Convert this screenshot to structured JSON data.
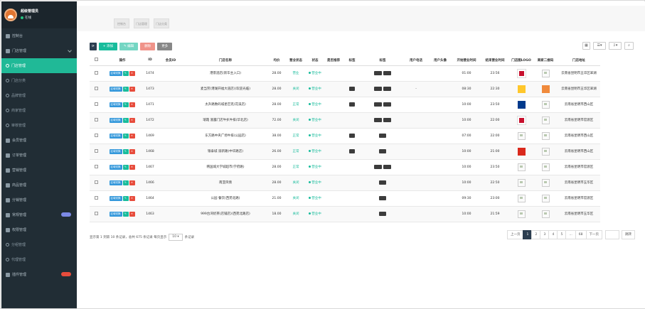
{
  "sidebar": {
    "user_name": "超级管理员",
    "user_status": "在线",
    "items": [
      {
        "label": "控制台",
        "type": "top"
      },
      {
        "label": "门店管理",
        "type": "top",
        "caret": true
      },
      {
        "label": "门店管理",
        "type": "active"
      },
      {
        "label": "门店分类",
        "type": "sub"
      },
      {
        "label": "品牌管理",
        "type": "sub"
      },
      {
        "label": "商家管理",
        "type": "sub"
      },
      {
        "label": "审核管理",
        "type": "sub"
      },
      {
        "label": "会员管理",
        "type": "top"
      },
      {
        "label": "订单管理",
        "type": "top"
      },
      {
        "label": "营销管理",
        "type": "top"
      },
      {
        "label": "商品管理",
        "type": "top"
      },
      {
        "label": "分销管理",
        "type": "top"
      },
      {
        "label": "常规管理",
        "type": "top",
        "badge_color": "#7c8ae6"
      },
      {
        "label": "权限管理",
        "type": "top"
      },
      {
        "label": "分组管理",
        "type": "sub"
      },
      {
        "label": "代理管理",
        "type": "sub"
      },
      {
        "label": "插件管理",
        "type": "top",
        "badge_color": "#e74c3c"
      }
    ]
  },
  "tabs": [
    "控制台",
    "门店管理",
    "门店分类"
  ],
  "toolbar": {
    "refresh": "⟳",
    "add": "+ 添加",
    "edit": "✎ 编辑",
    "delete": "删除",
    "more": "更多"
  },
  "table": {
    "headers": [
      "",
      "操作",
      "ID",
      "会员ID",
      "门店名称",
      "均价",
      "营业状态",
      "状态",
      "是否推荐",
      "标签",
      "标签",
      "用户电话",
      "用户头像",
      "开始营业时间",
      "结束营业时间",
      "门店图LOGO",
      "商家二维码",
      "门店地址"
    ],
    "rows": [
      {
        "id": "1474",
        "name": "港景酒店(新华主入口)",
        "price": "28.00",
        "open": "营业",
        "status": "营业中",
        "tags": "2",
        "phone": "",
        "start": "01:00",
        "end": "23:56",
        "logo": "kfc",
        "addr": "云南省昆明市五华区翠湖"
      },
      {
        "id": "1473",
        "name": "麦当劳(港湖开福大道店)(欢迎光临)",
        "price": "28.00",
        "open": "关闭",
        "status": "营业中",
        "tags": "2b",
        "phone": "-",
        "start": "08:30",
        "end": "22:30",
        "logo": "mcd",
        "addr": "云南省昆明市五华区翠湖"
      },
      {
        "id": "1471",
        "name": "太升路数码城星巴克(花溪店)",
        "price": "28.00",
        "open": "正常",
        "status": "营业中",
        "tags": "2b",
        "phone": "",
        "start": "10:00",
        "end": "23:50",
        "logo": "blue",
        "addr": "云南省昆明市西山区"
      },
      {
        "id": "1472",
        "name": "瑞霞 富露门店牛扒牛排(华北店)",
        "price": "72.00",
        "open": "关闭",
        "status": "营业中",
        "tags": "2",
        "phone": "",
        "start": "10:00",
        "end": "22:00",
        "logo": "kfc",
        "addr": "云南省昆明市官渡区"
      },
      {
        "id": "1469",
        "name": "东方路中央广场牛排(公园店)",
        "price": "38.00",
        "open": "正常",
        "status": "营业中",
        "tags": "1b",
        "phone": "",
        "start": "07:00",
        "end": "22:00",
        "logo": "ph",
        "addr": "云南省昆明市西山区"
      },
      {
        "id": "1468",
        "name": "银泰城 渝新路(中华路店)",
        "price": "26.00",
        "open": "正常",
        "status": "营业中",
        "tags": "1b",
        "phone": "",
        "start": "10:00",
        "end": "21:00",
        "logo": "mcd2",
        "addr": "云南省昆明市西山区"
      },
      {
        "id": "1467",
        "name": "韩国城大学城超市(学府路)",
        "price": "28.00",
        "open": "正常",
        "status": "营业中",
        "tags": "2",
        "phone": "",
        "start": "10:00",
        "end": "23:50",
        "logo": "ph",
        "addr": "云南省昆明市官渡区"
      },
      {
        "id": "1466",
        "name": "南亚风情",
        "price": "28.00",
        "open": "关闭",
        "status": "营业中",
        "tags": "1",
        "phone": "",
        "start": "10:00",
        "end": "22:50",
        "logo": "ph",
        "addr": "云南省昆明市五华区"
      },
      {
        "id": "1464",
        "name": "公园 餐饮(西苑北路)",
        "price": "21.00",
        "open": "关闭",
        "status": "营业中",
        "tags": "1",
        "phone": "",
        "start": "09:30",
        "end": "23:00",
        "logo": "ph",
        "addr": "云南省昆明市官渡区"
      },
      {
        "id": "1463",
        "name": "999台湾奶茶(店铺店)(西苑北路店)",
        "price": "18.00",
        "open": "关闭",
        "status": "营业中",
        "tags": "1",
        "phone": "",
        "start": "10:00",
        "end": "21:59",
        "logo": "ph",
        "addr": "云南省昆明市五华区"
      }
    ],
    "op_label": "区域切换"
  },
  "footer": {
    "summary": "显示第 1 到第 10 条记录，总共 675 条记录 每页显示",
    "per_page": "10",
    "suffix": "条记录"
  },
  "pager": {
    "prev": "上一页",
    "pages": [
      "1",
      "2",
      "3",
      "4",
      "5",
      "...",
      "68"
    ],
    "next": "下一页",
    "jump": "跳转"
  },
  "colors": {
    "accent": "#20b997",
    "sidebar": "#212d35",
    "primary": "#3498db",
    "danger": "#e74c3c"
  }
}
